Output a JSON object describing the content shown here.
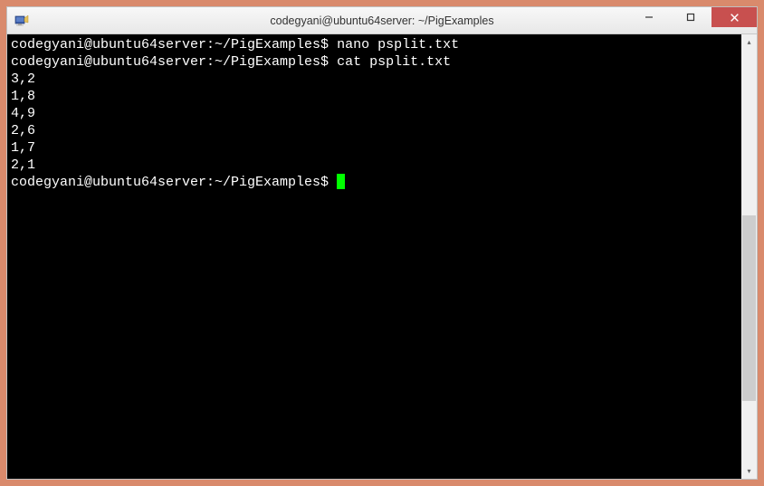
{
  "window": {
    "title": "codegyani@ubuntu64server: ~/PigExamples"
  },
  "terminal": {
    "lines": [
      {
        "prompt": "codegyani@ubuntu64server:~/PigExamples$ ",
        "cmd": "nano psplit.txt"
      },
      {
        "prompt": "codegyani@ubuntu64server:~/PigExamples$ ",
        "cmd": "cat psplit.txt"
      },
      {
        "text": "3,2"
      },
      {
        "text": "1,8"
      },
      {
        "text": "4,9"
      },
      {
        "text": "2,6"
      },
      {
        "text": "1,7"
      },
      {
        "text": "2,1"
      },
      {
        "prompt": "codegyani@ubuntu64server:~/PigExamples$ ",
        "cursor": true
      }
    ]
  },
  "controls": {
    "minimize": "—",
    "maximize": "☐",
    "close": "✕",
    "scrollUp": "▴",
    "scrollDown": "▾"
  }
}
